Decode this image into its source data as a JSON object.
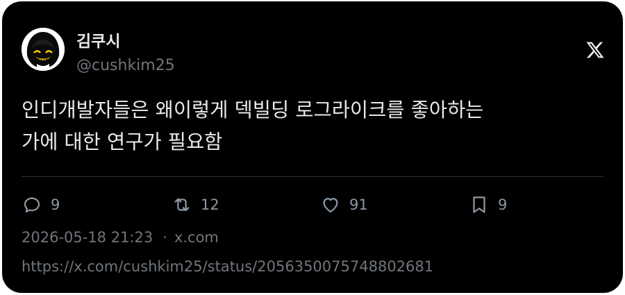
{
  "tweet": {
    "author": {
      "display_name": "김쿠시",
      "handle": "@cushkim25",
      "avatar_icon": "avatar-face-icon"
    },
    "platform_icon": "x-logo-icon",
    "text_line1": "인디개발자들은 왜이렇게 덱빌딩 로그라이크를 좋아하는",
    "text_line2": "가에 대한 연구가 필요함",
    "actions": {
      "replies": "9",
      "reposts": "12",
      "likes": "91",
      "bookmarks": "9"
    },
    "timestamp": "2026-05-18 21:23",
    "separator": "·",
    "source": "x.com",
    "url": "https://x.com/cushkim25/status/2056350075748802681"
  },
  "colors": {
    "card_bg": "#000000",
    "text_primary": "#e7e9ea",
    "text_secondary": "#71767b",
    "divider": "#2f3336",
    "page_bg": "#ffffff"
  }
}
